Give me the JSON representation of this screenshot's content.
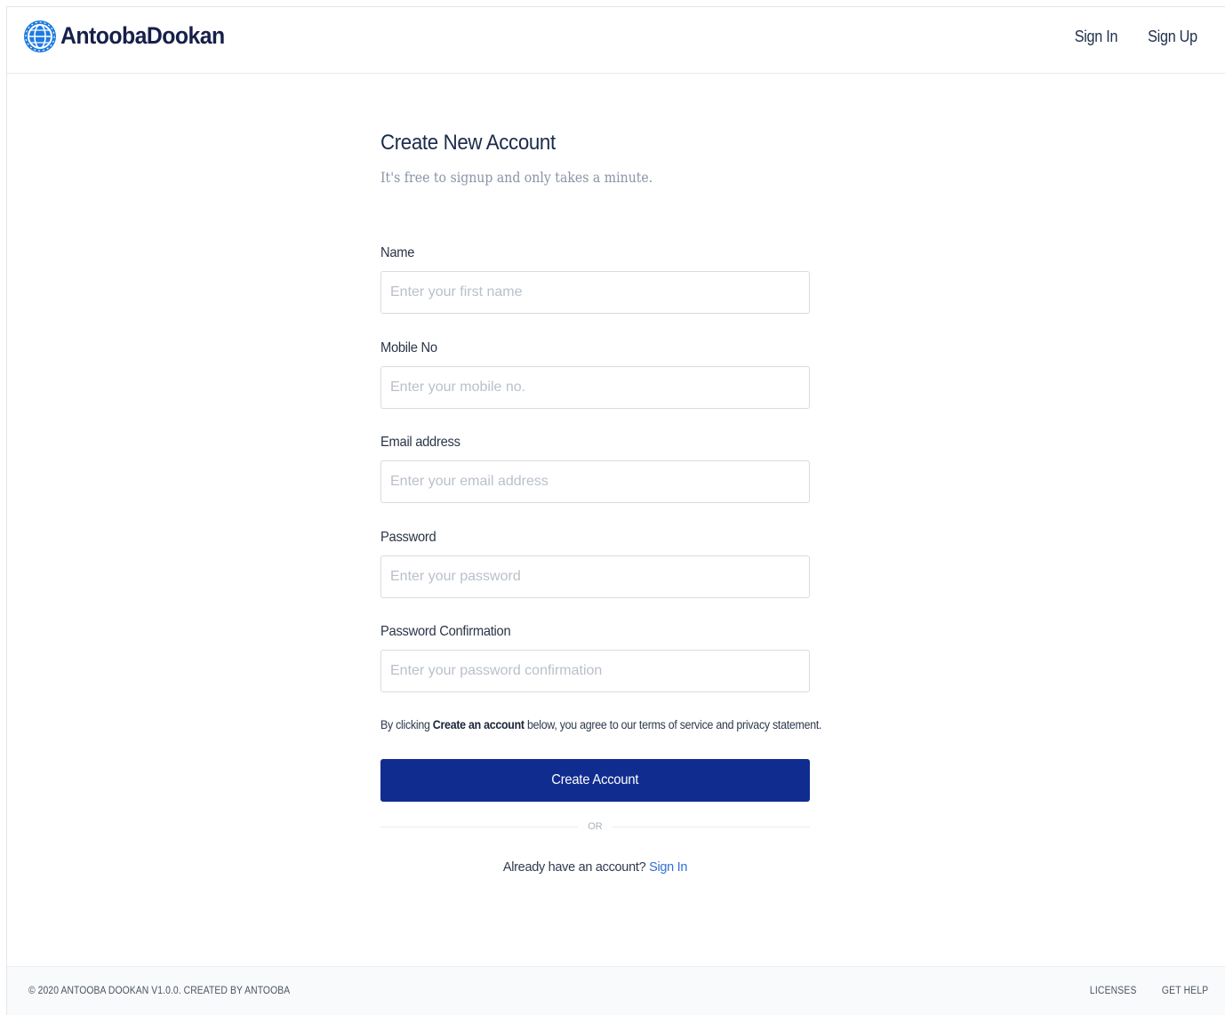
{
  "header": {
    "brand": "AntoobaDookan",
    "nav": {
      "sign_in": "Sign In",
      "sign_up": "Sign Up"
    }
  },
  "form": {
    "title": "Create New Account",
    "subtitle": "It's free to signup and only takes a minute.",
    "fields": [
      {
        "label": "Name",
        "placeholder": "Enter your first name",
        "value": ""
      },
      {
        "label": "Mobile No",
        "placeholder": "Enter your mobile no.",
        "value": ""
      },
      {
        "label": "Email address",
        "placeholder": "Enter your email address",
        "value": ""
      },
      {
        "label": "Password",
        "placeholder": "Enter your password",
        "value": ""
      },
      {
        "label": "Password Confirmation",
        "placeholder": "Enter your password confirmation",
        "value": ""
      }
    ],
    "agreement": {
      "prefix": "By clicking ",
      "emphasis": "Create an account",
      "suffix": " below, you agree to our terms of service and privacy statement."
    },
    "submit_label": "Create Account",
    "divider_text": "OR",
    "signin_prompt": "Already have an account?",
    "signin_link": "Sign In"
  },
  "footer": {
    "copyright": "© 2020 ANTOOBA DOOKAN V1.0.0. CREATED BY ANTOOBA",
    "links": {
      "licenses": "LICENSES",
      "get_help": "GET HELP"
    }
  },
  "colors": {
    "brand_blue": "#102c8f",
    "link_blue": "#2f6fd6",
    "logo_blue": "#1d7be0"
  },
  "icons": {
    "logo": "globe-gear-logo-icon"
  }
}
